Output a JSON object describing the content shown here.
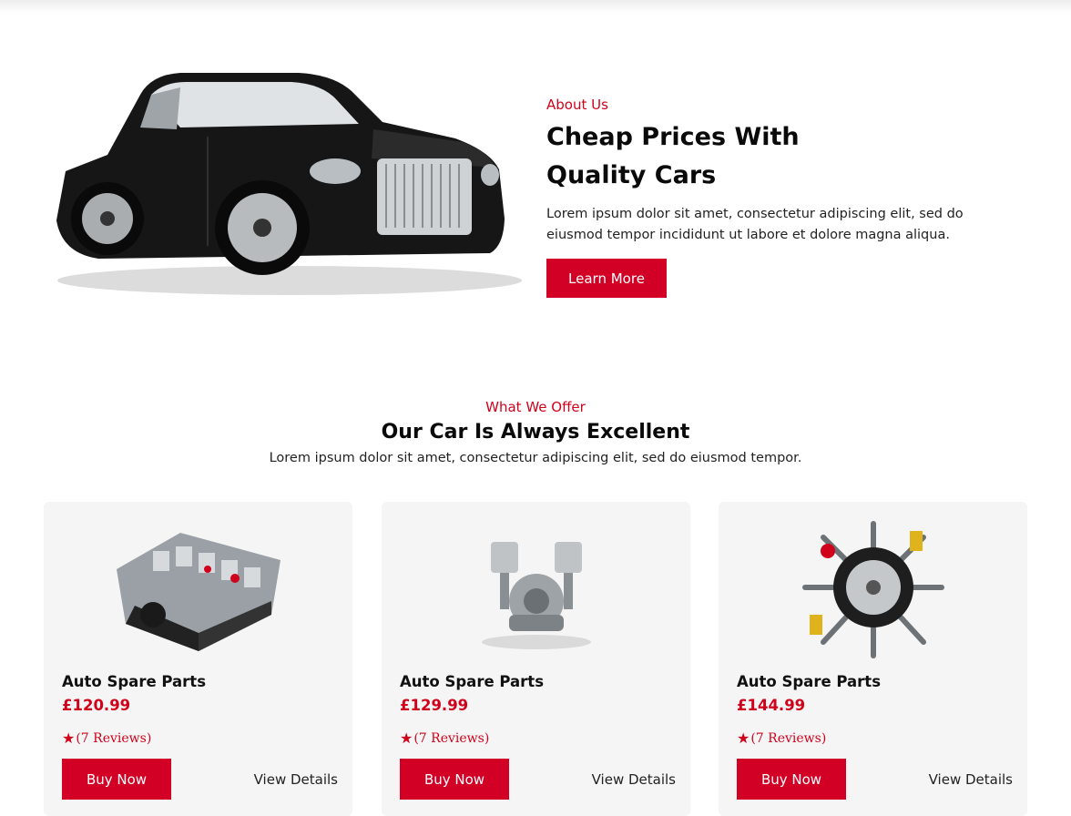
{
  "about": {
    "eyebrow": "About Us",
    "title": "Cheap Prices With Quality Cars",
    "description": "Lorem ipsum dolor sit amet, consectetur adipiscing elit, sed do eiusmod tempor incididunt ut labore et dolore magna aliqua.",
    "button_label": "Learn More"
  },
  "offer": {
    "eyebrow": "What We Offer",
    "title": "Our Car Is Always Excellent",
    "description": "Lorem ipsum dolor sit amet, consectetur adipiscing elit, sed do eiusmod tempor."
  },
  "products": [
    {
      "name": "Auto Spare Parts",
      "price": "£120.99",
      "rating_text": "(7 Reviews)",
      "buy_label": "Buy Now",
      "details_label": "View Details",
      "image": "engine-block"
    },
    {
      "name": "Auto Spare Parts",
      "price": "£129.99",
      "rating_text": "(7 Reviews)",
      "buy_label": "Buy Now",
      "details_label": "View Details",
      "image": "engine-pistons"
    },
    {
      "name": "Auto Spare Parts",
      "price": "£144.99",
      "rating_text": "(7 Reviews)",
      "buy_label": "Buy Now",
      "details_label": "View Details",
      "image": "wheel-and-tools"
    }
  ],
  "colors": {
    "accent": "#d10024",
    "card_bg": "#f5f5f5"
  }
}
